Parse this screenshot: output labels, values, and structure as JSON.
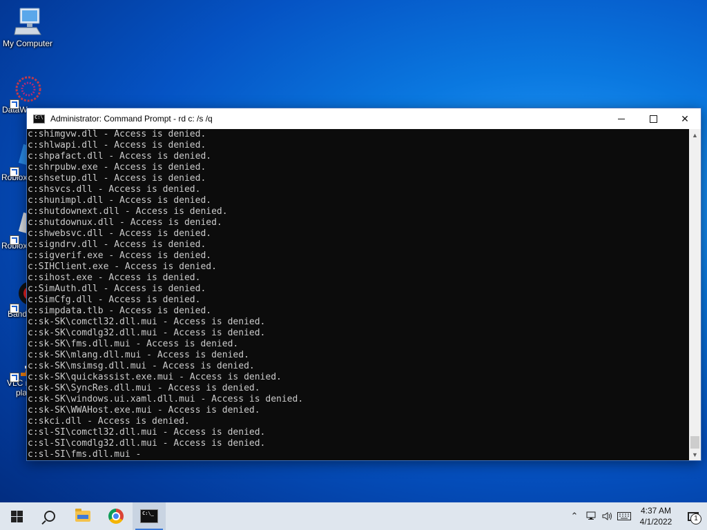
{
  "desktop": {
    "icons": [
      {
        "label": "My Computer",
        "icon": "computer-icon"
      },
      {
        "label": "DataW",
        "icon": "datawatch-icon"
      },
      {
        "label": "Roblox",
        "icon": "roblox-icon"
      },
      {
        "label": "Roblox",
        "icon": "roblox-studio-icon"
      },
      {
        "label": "Band",
        "icon": "bandicam-icon"
      },
      {
        "label": "VLC m",
        "label2": "pla",
        "icon": "vlc-icon"
      }
    ]
  },
  "console": {
    "title": "Administrator: Command Prompt - rd  c: /s /q",
    "text_color": "#cccccc",
    "background": "#0c0c0c",
    "lines": [
      "c:shimgvw.dll - Access is denied.",
      "c:shlwapi.dll - Access is denied.",
      "c:shpafact.dll - Access is denied.",
      "c:shrpubw.exe - Access is denied.",
      "c:shsetup.dll - Access is denied.",
      "c:shsvcs.dll - Access is denied.",
      "c:shunimpl.dll - Access is denied.",
      "c:shutdownext.dll - Access is denied.",
      "c:shutdownux.dll - Access is denied.",
      "c:shwebsvc.dll - Access is denied.",
      "c:signdrv.dll - Access is denied.",
      "c:sigverif.exe - Access is denied.",
      "c:SIHClient.exe - Access is denied.",
      "c:sihost.exe - Access is denied.",
      "c:SimAuth.dll - Access is denied.",
      "c:SimCfg.dll - Access is denied.",
      "c:simpdata.tlb - Access is denied.",
      "c:sk-SK\\comctl32.dll.mui - Access is denied.",
      "c:sk-SK\\comdlg32.dll.mui - Access is denied.",
      "c:sk-SK\\fms.dll.mui - Access is denied.",
      "c:sk-SK\\mlang.dll.mui - Access is denied.",
      "c:sk-SK\\msimsg.dll.mui - Access is denied.",
      "c:sk-SK\\quickassist.exe.mui - Access is denied.",
      "c:sk-SK\\SyncRes.dll.mui - Access is denied.",
      "c:sk-SK\\windows.ui.xaml.dll.mui - Access is denied.",
      "c:sk-SK\\WWAHost.exe.mui - Access is denied.",
      "c:skci.dll - Access is denied.",
      "c:sl-SI\\comctl32.dll.mui - Access is denied.",
      "c:sl-SI\\comdlg32.dll.mui - Access is denied.",
      "c:sl-SI\\fms.dll.mui -"
    ]
  },
  "taskbar": {
    "apps": [
      {
        "name": "start-button",
        "icon": "windows-logo-icon"
      },
      {
        "name": "search-button",
        "icon": "search-icon"
      },
      {
        "name": "file-explorer-button",
        "icon": "folder-icon"
      },
      {
        "name": "chrome-button",
        "icon": "chrome-icon"
      },
      {
        "name": "command-prompt-button",
        "icon": "cmd-icon",
        "active": true
      }
    ],
    "tray": {
      "icons": [
        "chevron-up-icon",
        "network-icon",
        "volume-icon",
        "keyboard-icon"
      ],
      "time": "4:37 AM",
      "date": "4/1/2022",
      "notification_count": "1"
    }
  }
}
